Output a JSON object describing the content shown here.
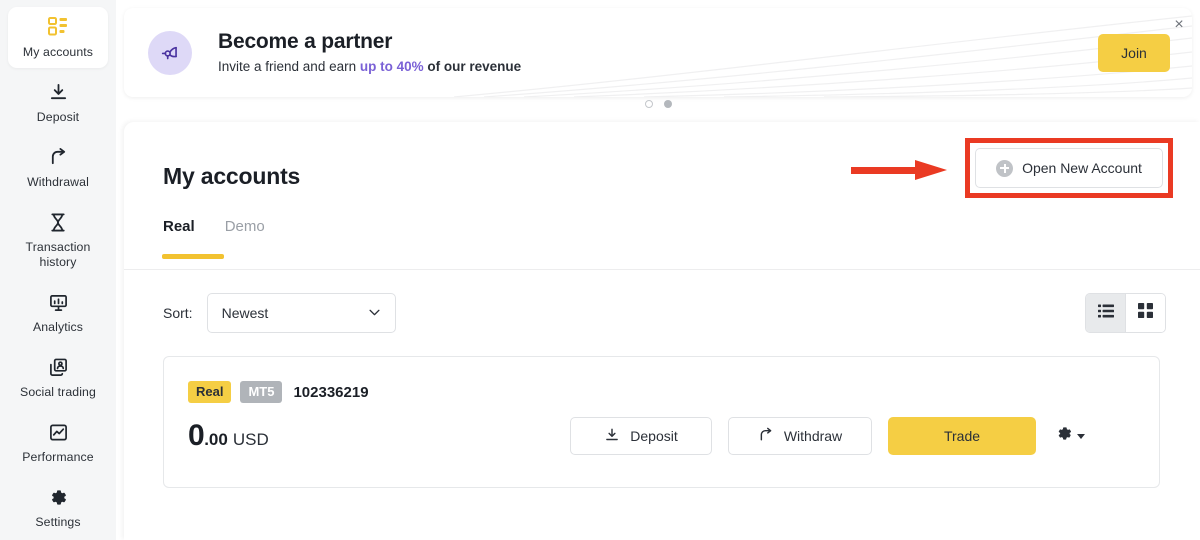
{
  "sidebar": {
    "items": [
      {
        "label": "My accounts",
        "icon": "dashboard-grid-icon",
        "active": true
      },
      {
        "label": "Deposit",
        "icon": "download-arrow-icon",
        "active": false
      },
      {
        "label": "Withdrawal",
        "icon": "upload-arrow-icon",
        "active": false
      },
      {
        "label": "Transaction history",
        "icon": "hourglass-icon",
        "active": false
      },
      {
        "label": "Analytics",
        "icon": "presentation-chart-icon",
        "active": false
      },
      {
        "label": "Social trading",
        "icon": "copy-people-icon",
        "active": false
      },
      {
        "label": "Performance",
        "icon": "line-chart-box-icon",
        "active": false
      },
      {
        "label": "Settings",
        "icon": "gear-icon",
        "active": false
      }
    ]
  },
  "banner": {
    "icon": "horn-megaphone-icon",
    "title": "Become a partner",
    "subtitle_prefix": "Invite a friend and earn ",
    "subtitle_accent": "up to 40%",
    "subtitle_suffix": " of our revenue",
    "join_label": "Join",
    "close_label": "×",
    "accent_color": "#7a61d6",
    "button_color": "#f5ce44",
    "icon_bg_color": "#ded9f7"
  },
  "carousel": {
    "dots": [
      {
        "state": "hollow"
      },
      {
        "state": "filled"
      }
    ]
  },
  "main": {
    "page_title": "My accounts",
    "open_account_label": "Open New Account",
    "open_account_icon": "plus-circle-icon",
    "annotation": {
      "highlight_color": "#ea3a23",
      "arrow_icon": "red-arrow-right-icon"
    },
    "tabs": [
      {
        "label": "Real",
        "active": true
      },
      {
        "label": "Demo",
        "active": false
      }
    ],
    "tab_underline_color": "#f2c230",
    "sort": {
      "label": "Sort:",
      "value": "Newest",
      "chevron_icon": "chevron-down-icon"
    },
    "view_toggle": [
      {
        "name": "list-view",
        "icon": "list-view-icon",
        "active": true
      },
      {
        "name": "grid-view",
        "icon": "grid-view-icon",
        "active": false
      }
    ],
    "accounts": [
      {
        "type_badge": "Real",
        "platform_badge": "MT5",
        "number": "102336219",
        "balance_integer": "0",
        "balance_decimal": ".00",
        "currency": "USD",
        "actions": [
          {
            "label": "Deposit",
            "icon": "download-arrow-icon",
            "style": "outline"
          },
          {
            "label": "Withdraw",
            "icon": "upload-arrow-icon",
            "style": "outline"
          },
          {
            "label": "Trade",
            "icon": "",
            "style": "primary"
          }
        ],
        "menu_icon": "gear-icon",
        "menu_caret_icon": "caret-down-icon"
      }
    ]
  }
}
